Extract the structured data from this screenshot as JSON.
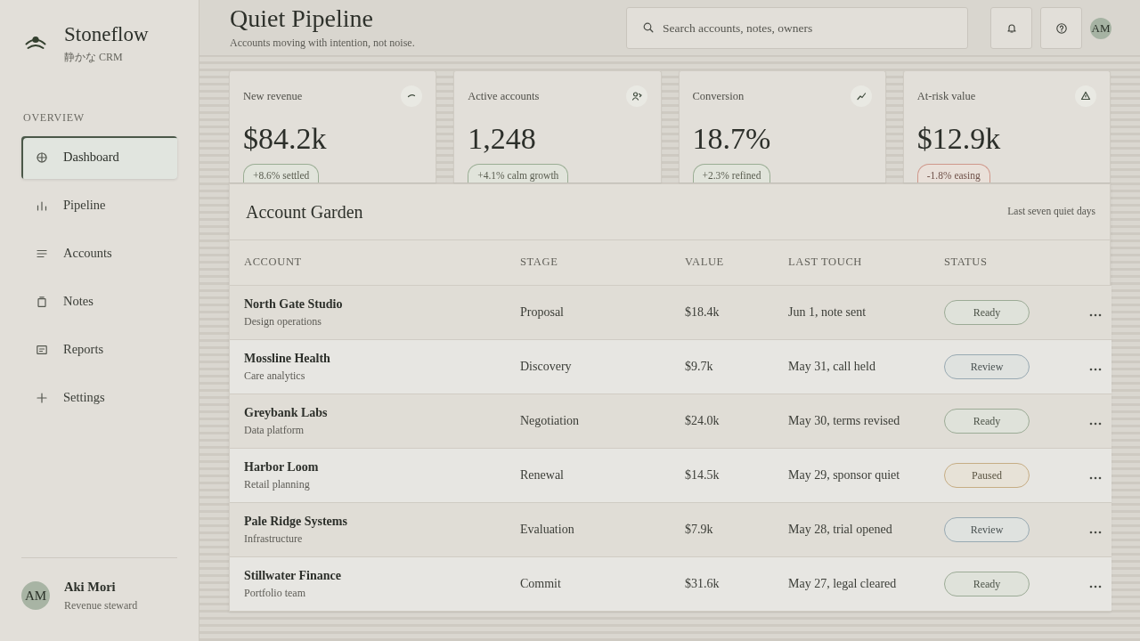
{
  "sidebar": {
    "brand": {
      "name": "Stoneflow",
      "tagline": "静かな CRM"
    },
    "section_label": "OVERVIEW",
    "nav": [
      {
        "label": "Dashboard",
        "selected": true
      },
      {
        "label": "Pipeline",
        "selected": false
      },
      {
        "label": "Accounts",
        "selected": false
      },
      {
        "label": "Notes",
        "selected": false
      },
      {
        "label": "Reports",
        "selected": false
      },
      {
        "label": "Settings",
        "selected": false
      }
    ],
    "user": {
      "initials": "AM",
      "name": "Aki Mori",
      "role": "Revenue steward"
    }
  },
  "header": {
    "title": "Quiet Pipeline",
    "subtitle": "Accounts moving with intention, not noise.",
    "search": {
      "placeholder": "Search accounts, notes, owners"
    },
    "avatar": {
      "initials": "AM"
    }
  },
  "stats": [
    {
      "label": "New revenue",
      "value": "$84.2k",
      "delta": {
        "text": "+8.6% settled",
        "color": "#9aad94"
      }
    },
    {
      "label": "Active accounts",
      "value": "1,248",
      "delta": {
        "text": "+4.1% calm growth",
        "color": "#9aad94"
      }
    },
    {
      "label": "Conversion",
      "value": "18.7%",
      "delta": {
        "text": "+2.3% refined",
        "color": "#9aad94"
      }
    },
    {
      "label": "At-risk value",
      "value": "$12.9k",
      "delta": {
        "text": "-1.8% easing",
        "color": "#cf978a"
      }
    }
  ],
  "table": {
    "title": "Account Garden",
    "range": "Last seven quiet days",
    "columns": [
      "ACCOUNT",
      "STAGE",
      "VALUE",
      "LAST TOUCH",
      "STATUS"
    ],
    "rows": [
      {
        "account": "North Gate Studio",
        "segment": "Design operations",
        "stage": "Proposal",
        "value": "$18.4k",
        "last_touch": "Jun 1, note sent",
        "status": {
          "label": "Ready",
          "color": "#9cab96"
        }
      },
      {
        "account": "Mossline Health",
        "segment": "Care analytics",
        "stage": "Discovery",
        "value": "$9.7k",
        "last_touch": "May 31, call held",
        "status": {
          "label": "Review",
          "color": "#98a9b2"
        }
      },
      {
        "account": "Greybank Labs",
        "segment": "Data platform",
        "stage": "Negotiation",
        "value": "$24.0k",
        "last_touch": "May 30, terms revised",
        "status": {
          "label": "Ready",
          "color": "#9cab96"
        }
      },
      {
        "account": "Harbor Loom",
        "segment": "Retail planning",
        "stage": "Renewal",
        "value": "$14.5k",
        "last_touch": "May 29, sponsor quiet",
        "status": {
          "label": "Paused",
          "color": "#c6ad84"
        }
      },
      {
        "account": "Pale Ridge Systems",
        "segment": "Infrastructure",
        "stage": "Evaluation",
        "value": "$7.9k",
        "last_touch": "May 28, trial opened",
        "status": {
          "label": "Review",
          "color": "#98a9b2"
        }
      },
      {
        "account": "Stillwater Finance",
        "segment": "Portfolio team",
        "stage": "Commit",
        "value": "$31.6k",
        "last_touch": "May 27, legal cleared",
        "status": {
          "label": "Ready",
          "color": "#9cab96"
        }
      }
    ]
  }
}
